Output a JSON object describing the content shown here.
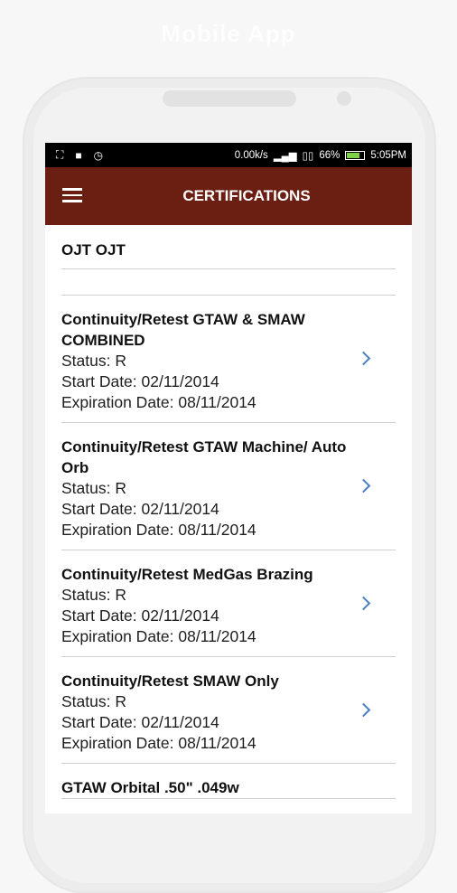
{
  "headline": "Mobile App",
  "status_bar": {
    "left_icons": [
      "screenshot-icon",
      "lock-icon",
      "alarm-icon"
    ],
    "speed": "0.00k/s",
    "battery_percent": "66%",
    "time": "5:05PM"
  },
  "app_bar": {
    "title": "CERTIFICATIONS",
    "menu_icon": "hamburger-menu-icon"
  },
  "section": {
    "ojt_label": "OJT OJT"
  },
  "certifications": [
    {
      "title": "Continuity/Retest GTAW & SMAW COMBINED",
      "status": "Status: R",
      "start": "Start Date: 02/11/2014",
      "expiration": "Expiration Date: 08/11/2014"
    },
    {
      "title": "Continuity/Retest GTAW Machine/ Auto Orb",
      "status": "Status: R",
      "start": "Start Date: 02/11/2014",
      "expiration": "Expiration Date: 08/11/2014"
    },
    {
      "title": "Continuity/Retest MedGas Brazing",
      "status": "Status: R",
      "start": "Start Date: 02/11/2014",
      "expiration": "Expiration Date: 08/11/2014"
    },
    {
      "title": "Continuity/Retest SMAW Only",
      "status": "Status: R",
      "start": "Start Date: 02/11/2014",
      "expiration": "Expiration Date: 08/11/2014"
    },
    {
      "title": "GTAW Orbital .50\" .049w"
    }
  ],
  "colors": {
    "app_bar": "#6b1f12",
    "chevron": "#4a7fc1",
    "divider": "#cfcfcf"
  }
}
